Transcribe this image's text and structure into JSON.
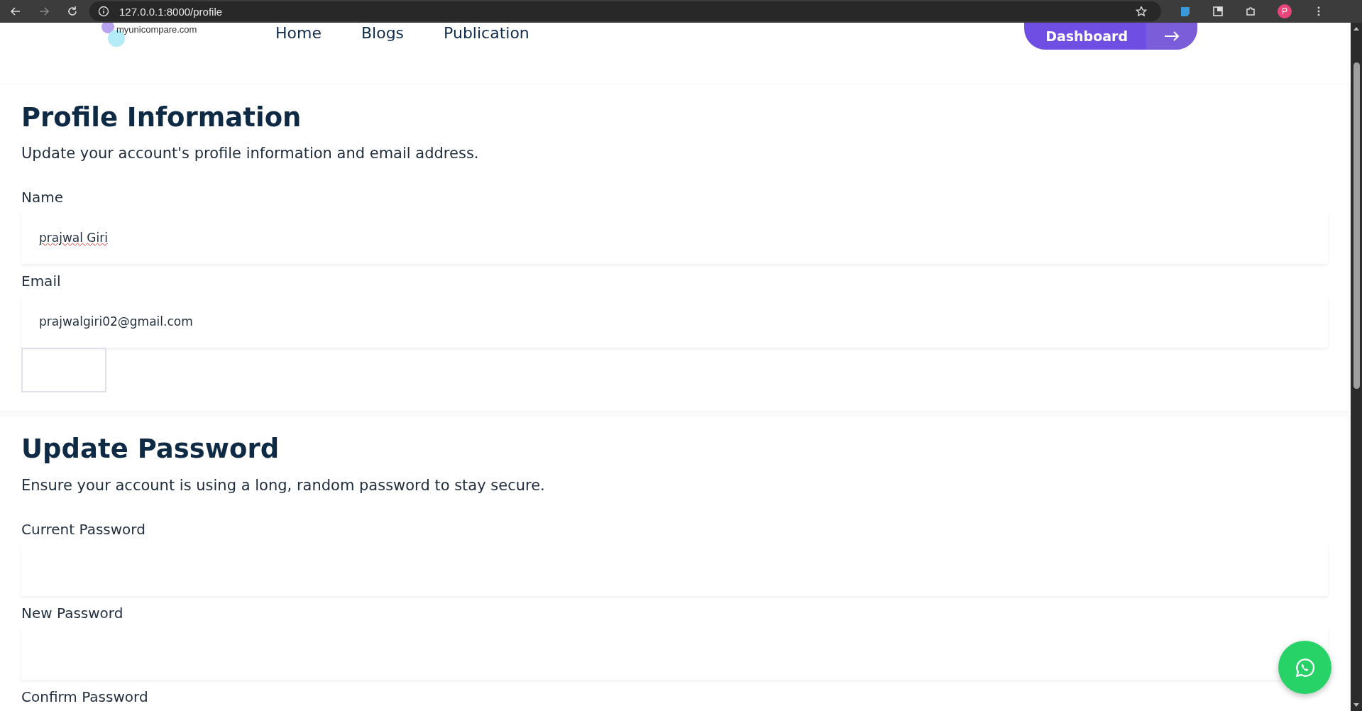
{
  "browser": {
    "url": "127.0.0.1:8000/profile",
    "profile_initial": "P"
  },
  "header": {
    "logo_text": "myunicompare.com",
    "nav": [
      {
        "label": "Home"
      },
      {
        "label": "Blogs"
      },
      {
        "label": "Publication"
      }
    ],
    "cta": {
      "label": "Dashboard"
    }
  },
  "sections": [
    {
      "title": "Profile Information",
      "subtitle": "Update your account's profile information and email address.",
      "fields": [
        {
          "kind": "input",
          "label": "Name",
          "value": "prajwal Giri",
          "spellcheck_error": true
        },
        {
          "kind": "input",
          "label": "Email",
          "value": "prajwalgiri02@gmail.com"
        }
      ],
      "empty_button": true
    },
    {
      "title": "Update Password",
      "subtitle": "Ensure your account is using a long, random password to stay secure.",
      "fields": [
        {
          "kind": "input",
          "label": "Current Password"
        },
        {
          "kind": "input",
          "label": "New Password"
        },
        {
          "kind": "label",
          "label": "Confirm Password"
        }
      ]
    }
  ]
}
